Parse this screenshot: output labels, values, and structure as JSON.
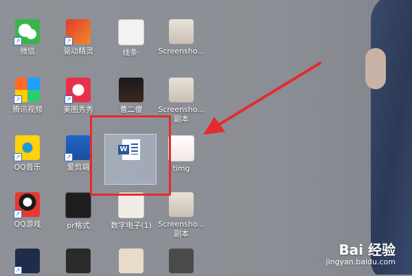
{
  "desktop": {
    "icons": [
      {
        "name": "wechat",
        "label": "微信",
        "icon": "wechat-icon"
      },
      {
        "name": "qudong",
        "label": "驱动精灵",
        "icon": "driver-genius-icon"
      },
      {
        "name": "xiantiao",
        "label": "线条·",
        "icon": "image-file-icon"
      },
      {
        "name": "screenshot-1",
        "label": "Screensho...",
        "icon": "image-file-icon"
      },
      {
        "name": "tencent-video",
        "label": "腾讯视频",
        "icon": "tencent-video-icon"
      },
      {
        "name": "meitu",
        "label": "美图秀秀",
        "icon": "meitu-icon"
      },
      {
        "name": "caoer",
        "label": "曹二傻",
        "icon": "image-file-icon"
      },
      {
        "name": "screenshot-2",
        "label": "Screensho...",
        "label2": "副本",
        "icon": "image-file-icon"
      },
      {
        "name": "qqmusic",
        "label": "QQ音乐",
        "icon": "qq-music-icon"
      },
      {
        "name": "aijian",
        "label": "爱剪辑",
        "icon": "video-editor-icon"
      },
      {
        "name": "timg",
        "label": "timg",
        "icon": "image-file-icon"
      },
      {
        "name": "qqgame",
        "label": "QQ游戏",
        "icon": "qq-game-icon"
      },
      {
        "name": "prgeshi",
        "label": "pr格式",
        "icon": "image-file-icon"
      },
      {
        "name": "shuzi",
        "label": "数字电子(1)",
        "icon": "image-file-icon"
      },
      {
        "name": "screenshot-3",
        "label": "Screensho...",
        "label2": "副本",
        "icon": "image-file-icon"
      }
    ],
    "selected_file": {
      "icon": "word-document-icon",
      "label": ""
    }
  },
  "annotation": {
    "arrow_color": "#e42b2b",
    "box_color": "#e42b2b"
  },
  "watermark": {
    "top": "Bai 经验",
    "bottom": "jingyan.baidu.com"
  }
}
